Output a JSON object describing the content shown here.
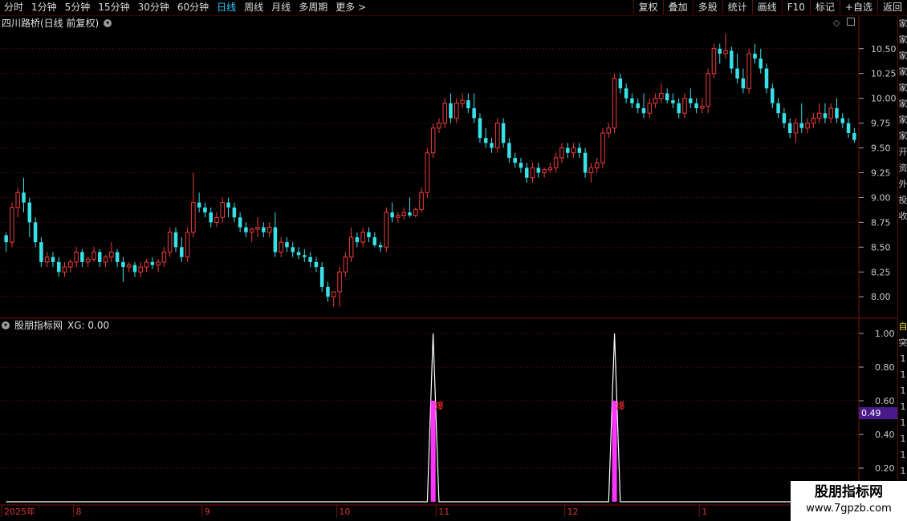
{
  "toolbar": {
    "periods": [
      "分时",
      "1分钟",
      "5分钟",
      "15分钟",
      "30分钟",
      "60分钟",
      "日线",
      "周线",
      "月线",
      "多周期",
      "更多 >"
    ],
    "active_period": "日线",
    "right_tools": [
      "复权",
      "叠加",
      "多股",
      "统计",
      "画线",
      "F10",
      "标记",
      "+自选",
      "返回"
    ]
  },
  "price_panel": {
    "title": "四川路桥(日线 前复权)",
    "y_ticks": [
      "10.50",
      "10.25",
      "10.00",
      "9.75",
      "9.50",
      "9.25",
      "9.00",
      "8.75",
      "8.50",
      "8.25",
      "8.00"
    ]
  },
  "indicator_panel": {
    "title": "股朋指标网",
    "value_label": "XG: 0.00",
    "y_ticks": [
      "1.00",
      "0.80",
      "0.60",
      "0.40",
      "0.20"
    ],
    "current_value": "0.49",
    "signal_label": "爆"
  },
  "date_axis": {
    "labels": [
      "2025年",
      "8",
      "9",
      "10",
      "11",
      "12",
      "1"
    ]
  },
  "side_strip": {
    "chars": [
      "家",
      "家",
      "家",
      "家",
      "家",
      "家",
      "家",
      "家",
      "开",
      "资",
      "外",
      "投",
      "收"
    ],
    "ind_chars": [
      "自",
      "突",
      "1",
      "1",
      "1",
      "1",
      "1",
      "1",
      "1",
      "1",
      "1"
    ]
  },
  "watermark": {
    "title": "股朋指标网",
    "url": "www.7gpzb.com"
  },
  "colors": {
    "up": "#f23c3c",
    "down": "#38e0e8",
    "grid": "#7a1010",
    "signal": "#ff33ff",
    "accent": "#38c8ff"
  },
  "chart_data": {
    "type": "candlestick",
    "price_axis": {
      "ylim": [
        7.8,
        10.7
      ],
      "ticks": [
        8.0,
        8.25,
        8.5,
        8.75,
        9.0,
        9.25,
        9.5,
        9.75,
        10.0,
        10.25,
        10.5
      ]
    },
    "ohlc": [
      [
        8.62,
        8.65,
        8.45,
        8.55
      ],
      [
        8.55,
        8.95,
        8.5,
        8.9
      ],
      [
        8.9,
        9.1,
        8.8,
        9.05
      ],
      [
        9.05,
        9.2,
        8.85,
        8.95
      ],
      [
        8.95,
        9.0,
        8.6,
        8.75
      ],
      [
        8.75,
        8.8,
        8.5,
        8.55
      ],
      [
        8.55,
        8.6,
        8.3,
        8.35
      ],
      [
        8.35,
        8.45,
        8.3,
        8.4
      ],
      [
        8.4,
        8.45,
        8.3,
        8.35
      ],
      [
        8.35,
        8.4,
        8.2,
        8.25
      ],
      [
        8.25,
        8.35,
        8.2,
        8.3
      ],
      [
        8.3,
        8.38,
        8.25,
        8.35
      ],
      [
        8.35,
        8.5,
        8.3,
        8.45
      ],
      [
        8.45,
        8.48,
        8.3,
        8.35
      ],
      [
        8.35,
        8.4,
        8.3,
        8.38
      ],
      [
        8.38,
        8.5,
        8.35,
        8.45
      ],
      [
        8.45,
        8.48,
        8.3,
        8.35
      ],
      [
        8.35,
        8.42,
        8.3,
        8.4
      ],
      [
        8.4,
        8.55,
        8.35,
        8.45
      ],
      [
        8.45,
        8.48,
        8.3,
        8.35
      ],
      [
        8.35,
        8.4,
        8.15,
        8.3
      ],
      [
        8.3,
        8.35,
        8.25,
        8.32
      ],
      [
        8.32,
        8.35,
        8.2,
        8.25
      ],
      [
        8.25,
        8.35,
        8.2,
        8.3
      ],
      [
        8.3,
        8.38,
        8.25,
        8.35
      ],
      [
        8.35,
        8.4,
        8.28,
        8.32
      ],
      [
        8.32,
        8.38,
        8.25,
        8.35
      ],
      [
        8.35,
        8.5,
        8.3,
        8.45
      ],
      [
        8.45,
        8.7,
        8.4,
        8.65
      ],
      [
        8.65,
        8.7,
        8.45,
        8.5
      ],
      [
        8.5,
        8.6,
        8.35,
        8.4
      ],
      [
        8.4,
        8.7,
        8.35,
        8.65
      ],
      [
        8.65,
        9.25,
        8.6,
        8.95
      ],
      [
        8.95,
        9.05,
        8.85,
        8.9
      ],
      [
        8.9,
        8.95,
        8.8,
        8.85
      ],
      [
        8.85,
        8.9,
        8.7,
        8.75
      ],
      [
        8.75,
        8.85,
        8.7,
        8.8
      ],
      [
        8.8,
        9.0,
        8.75,
        8.95
      ],
      [
        8.95,
        9.0,
        8.8,
        8.9
      ],
      [
        8.9,
        8.95,
        8.75,
        8.8
      ],
      [
        8.8,
        8.85,
        8.65,
        8.7
      ],
      [
        8.7,
        8.75,
        8.6,
        8.65
      ],
      [
        8.65,
        8.7,
        8.55,
        8.68
      ],
      [
        8.68,
        8.8,
        8.6,
        8.7
      ],
      [
        8.7,
        8.75,
        8.6,
        8.65
      ],
      [
        8.65,
        8.75,
        8.6,
        8.7
      ],
      [
        8.7,
        8.85,
        8.4,
        8.45
      ],
      [
        8.45,
        8.6,
        8.4,
        8.55
      ],
      [
        8.55,
        8.6,
        8.45,
        8.5
      ],
      [
        8.5,
        8.55,
        8.4,
        8.45
      ],
      [
        8.45,
        8.5,
        8.38,
        8.42
      ],
      [
        8.42,
        8.48,
        8.35,
        8.4
      ],
      [
        8.4,
        8.45,
        8.3,
        8.35
      ],
      [
        8.35,
        8.4,
        8.25,
        8.3
      ],
      [
        8.3,
        8.35,
        8.05,
        8.1
      ],
      [
        8.1,
        8.15,
        7.95,
        8.0
      ],
      [
        8.0,
        8.05,
        7.9,
        8.05
      ],
      [
        8.05,
        8.3,
        7.9,
        8.25
      ],
      [
        8.25,
        8.45,
        8.2,
        8.4
      ],
      [
        8.4,
        8.7,
        8.35,
        8.6
      ],
      [
        8.6,
        8.65,
        8.5,
        8.55
      ],
      [
        8.55,
        8.7,
        8.5,
        8.65
      ],
      [
        8.65,
        8.7,
        8.55,
        8.6
      ],
      [
        8.6,
        8.65,
        8.5,
        8.52
      ],
      [
        8.52,
        8.55,
        8.45,
        8.5
      ],
      [
        8.5,
        8.9,
        8.45,
        8.85
      ],
      [
        8.85,
        8.95,
        8.75,
        8.8
      ],
      [
        8.8,
        8.85,
        8.75,
        8.82
      ],
      [
        8.82,
        8.9,
        8.78,
        8.85
      ],
      [
        8.85,
        9.0,
        8.8,
        8.82
      ],
      [
        8.82,
        8.9,
        8.8,
        8.88
      ],
      [
        8.88,
        9.1,
        8.85,
        9.05
      ],
      [
        9.05,
        9.5,
        9.0,
        9.45
      ],
      [
        9.45,
        9.75,
        9.4,
        9.7
      ],
      [
        9.7,
        9.8,
        9.65,
        9.75
      ],
      [
        9.75,
        10.0,
        9.7,
        9.95
      ],
      [
        9.95,
        10.05,
        9.75,
        9.8
      ],
      [
        9.8,
        10.0,
        9.75,
        9.95
      ],
      [
        9.95,
        10.05,
        9.9,
        9.98
      ],
      [
        9.98,
        10.05,
        9.85,
        9.9
      ],
      [
        9.9,
        10.05,
        9.75,
        9.8
      ],
      [
        9.8,
        9.85,
        9.55,
        9.6
      ],
      [
        9.6,
        9.7,
        9.5,
        9.55
      ],
      [
        9.55,
        9.6,
        9.45,
        9.5
      ],
      [
        9.5,
        9.8,
        9.45,
        9.75
      ],
      [
        9.75,
        9.8,
        9.5,
        9.55
      ],
      [
        9.55,
        9.6,
        9.35,
        9.4
      ],
      [
        9.4,
        9.45,
        9.3,
        9.35
      ],
      [
        9.35,
        9.4,
        9.25,
        9.3
      ],
      [
        9.3,
        9.35,
        9.15,
        9.2
      ],
      [
        9.2,
        9.35,
        9.15,
        9.3
      ],
      [
        9.3,
        9.35,
        9.2,
        9.25
      ],
      [
        9.25,
        9.3,
        9.2,
        9.28
      ],
      [
        9.28,
        9.35,
        9.25,
        9.3
      ],
      [
        9.3,
        9.45,
        9.25,
        9.4
      ],
      [
        9.4,
        9.55,
        9.35,
        9.5
      ],
      [
        9.5,
        9.55,
        9.4,
        9.45
      ],
      [
        9.45,
        9.55,
        9.4,
        9.5
      ],
      [
        9.5,
        9.55,
        9.4,
        9.45
      ],
      [
        9.45,
        9.5,
        9.2,
        9.25
      ],
      [
        9.25,
        9.35,
        9.15,
        9.3
      ],
      [
        9.3,
        9.4,
        9.25,
        9.35
      ],
      [
        9.35,
        9.7,
        9.3,
        9.65
      ],
      [
        9.65,
        9.75,
        9.6,
        9.7
      ],
      [
        9.7,
        10.25,
        9.65,
        10.2
      ],
      [
        10.2,
        10.25,
        10.05,
        10.1
      ],
      [
        10.1,
        10.15,
        9.95,
        10.0
      ],
      [
        10.0,
        10.05,
        9.9,
        9.95
      ],
      [
        9.95,
        10.0,
        9.85,
        9.9
      ],
      [
        9.9,
        10.05,
        9.8,
        9.85
      ],
      [
        9.85,
        10.0,
        9.8,
        9.95
      ],
      [
        9.95,
        10.05,
        9.9,
        10.0
      ],
      [
        10.0,
        10.15,
        9.95,
        10.05
      ],
      [
        10.05,
        10.1,
        9.95,
        9.98
      ],
      [
        9.98,
        10.05,
        9.9,
        9.95
      ],
      [
        9.95,
        10.0,
        9.8,
        9.85
      ],
      [
        9.85,
        10.05,
        9.8,
        10.0
      ],
      [
        10.0,
        10.1,
        9.9,
        9.95
      ],
      [
        9.95,
        10.0,
        9.85,
        9.9
      ],
      [
        9.9,
        10.0,
        9.85,
        9.92
      ],
      [
        9.92,
        10.3,
        9.85,
        10.25
      ],
      [
        10.25,
        10.55,
        10.2,
        10.5
      ],
      [
        10.5,
        10.55,
        10.35,
        10.45
      ],
      [
        10.45,
        10.65,
        10.4,
        10.48
      ],
      [
        10.48,
        10.52,
        10.25,
        10.3
      ],
      [
        10.3,
        10.45,
        10.15,
        10.2
      ],
      [
        10.2,
        10.3,
        10.05,
        10.1
      ],
      [
        10.1,
        10.5,
        10.05,
        10.45
      ],
      [
        10.45,
        10.55,
        10.35,
        10.4
      ],
      [
        10.4,
        10.5,
        10.25,
        10.3
      ],
      [
        10.3,
        10.35,
        10.05,
        10.1
      ],
      [
        10.1,
        10.15,
        9.9,
        9.95
      ],
      [
        9.95,
        10.0,
        9.8,
        9.85
      ],
      [
        9.85,
        9.9,
        9.7,
        9.75
      ],
      [
        9.75,
        9.8,
        9.6,
        9.65
      ],
      [
        9.65,
        9.8,
        9.55,
        9.75
      ],
      [
        9.75,
        9.95,
        9.65,
        9.7
      ],
      [
        9.7,
        9.8,
        9.65,
        9.75
      ],
      [
        9.75,
        9.85,
        9.7,
        9.8
      ],
      [
        9.8,
        9.95,
        9.75,
        9.85
      ],
      [
        9.85,
        9.95,
        9.75,
        9.8
      ],
      [
        9.8,
        9.95,
        9.75,
        9.9
      ],
      [
        9.9,
        10.0,
        9.75,
        9.8
      ],
      [
        9.8,
        9.85,
        9.7,
        9.75
      ],
      [
        9.75,
        9.8,
        9.6,
        9.65
      ],
      [
        9.65,
        9.7,
        9.55,
        9.58
      ]
    ],
    "indicator": {
      "series": "XG",
      "ylim": [
        0,
        1.0
      ],
      "ticks": [
        0.2,
        0.4,
        0.6,
        0.8,
        1.0
      ],
      "spikes": [
        {
          "index": 73,
          "value": 1.0
        },
        {
          "index": 104,
          "value": 1.0
        }
      ]
    },
    "date_ticks": [
      {
        "label": "2025年",
        "index": 0
      },
      {
        "label": "8",
        "index": 12
      },
      {
        "label": "9",
        "index": 34
      },
      {
        "label": "10",
        "index": 57
      },
      {
        "label": "11",
        "index": 74
      },
      {
        "label": "12",
        "index": 96
      },
      {
        "label": "1",
        "index": 119
      }
    ]
  }
}
